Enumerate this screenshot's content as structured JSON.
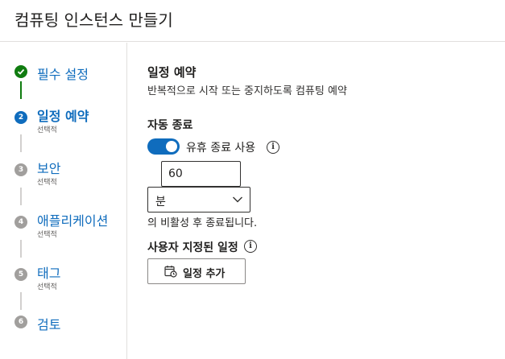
{
  "header": {
    "title": "컴퓨팅 인스턴스 만들기"
  },
  "steps": [
    {
      "number": "1",
      "label": "필수 설정",
      "sub": "",
      "state": "done"
    },
    {
      "number": "2",
      "label": "일정 예약",
      "sub": "선택적",
      "state": "active"
    },
    {
      "number": "3",
      "label": "보안",
      "sub": "선택적",
      "state": "pending"
    },
    {
      "number": "4",
      "label": "애플리케이션",
      "sub": "선택적",
      "state": "pending"
    },
    {
      "number": "5",
      "label": "태그",
      "sub": "선택적",
      "state": "pending"
    },
    {
      "number": "6",
      "label": "검토",
      "sub": "",
      "state": "pending"
    }
  ],
  "main": {
    "title": "일정 예약",
    "description": "반복적으로 시작 또는 중지하도록 컴퓨팅 예약",
    "auto_shutdown": {
      "heading": "자동 종료",
      "toggle_label": "유휴 종료 사용",
      "toggle_on": true,
      "idle_value": "60",
      "unit_selected": "분",
      "after_text": "의 비활성 후 종료됩니다."
    },
    "custom_schedule": {
      "heading": "사용자 지정된 일정",
      "add_button": "일정 추가"
    }
  },
  "colors": {
    "accent": "#0f6cbd",
    "done": "#107c10",
    "pending": "#a19f9d"
  },
  "icons": {
    "done_step": "checkmark-icon",
    "info": "info-icon",
    "dropdown": "chevron-down-icon",
    "add_schedule": "calendar-clock-icon"
  }
}
